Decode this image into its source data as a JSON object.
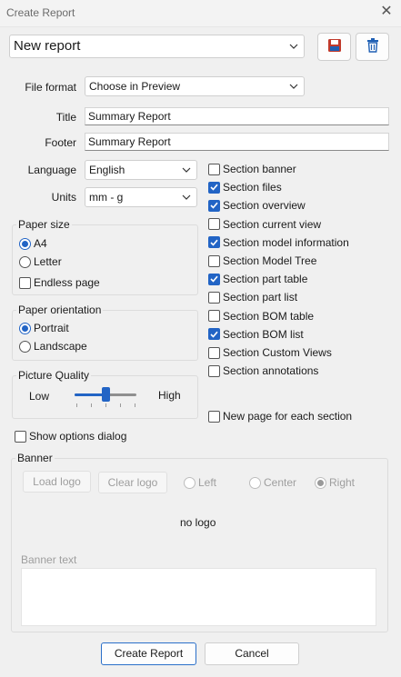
{
  "window": {
    "title": "Create Report",
    "close_glyph": "✕"
  },
  "report": {
    "selected": "New report"
  },
  "file_format": {
    "label": "File format",
    "value": "Choose in Preview"
  },
  "title_field": {
    "label": "Title",
    "value": "Summary Report"
  },
  "footer_field": {
    "label": "Footer",
    "value": "Summary Report"
  },
  "language": {
    "label": "Language",
    "value": "English"
  },
  "units": {
    "label": "Units",
    "value": "mm - g"
  },
  "paper_size": {
    "title": "Paper size",
    "a4": "A4",
    "letter": "Letter",
    "endless": "Endless page",
    "selected": "A4",
    "endless_checked": false
  },
  "paper_orientation": {
    "title": "Paper orientation",
    "portrait": "Portrait",
    "landscape": "Landscape",
    "selected": "Portrait"
  },
  "picture_quality": {
    "title": "Picture Quality",
    "low": "Low",
    "high": "High",
    "level": 0.5
  },
  "sections": [
    {
      "label": "Section banner",
      "checked": false
    },
    {
      "label": "Section files",
      "checked": true
    },
    {
      "label": "Section overview",
      "checked": true
    },
    {
      "label": "Section current view",
      "checked": false
    },
    {
      "label": "Section model information",
      "checked": true
    },
    {
      "label": "Section Model Tree",
      "checked": false
    },
    {
      "label": "Section part table",
      "checked": true
    },
    {
      "label": "Section part list",
      "checked": false
    },
    {
      "label": "Section BOM table",
      "checked": false
    },
    {
      "label": "Section BOM list",
      "checked": true
    },
    {
      "label": "Section Custom Views",
      "checked": false
    },
    {
      "label": "Section annotations",
      "checked": false
    }
  ],
  "new_page_each_section": {
    "label": "New page for each section",
    "checked": false
  },
  "show_options_dialog": {
    "label": "Show options dialog",
    "checked": false
  },
  "banner": {
    "title": "Banner",
    "load_logo": "Load logo",
    "clear_logo": "Clear logo",
    "left": "Left",
    "center": "Center",
    "right": "Right",
    "align_selected": "Right",
    "no_logo": "no logo",
    "banner_text_label": "Banner text",
    "banner_text_value": ""
  },
  "actions": {
    "create": "Create Report",
    "cancel": "Cancel"
  },
  "colors": {
    "accent": "#2264c5",
    "save_icon": "#c0392b",
    "delete_icon": "#1e5fb4"
  }
}
